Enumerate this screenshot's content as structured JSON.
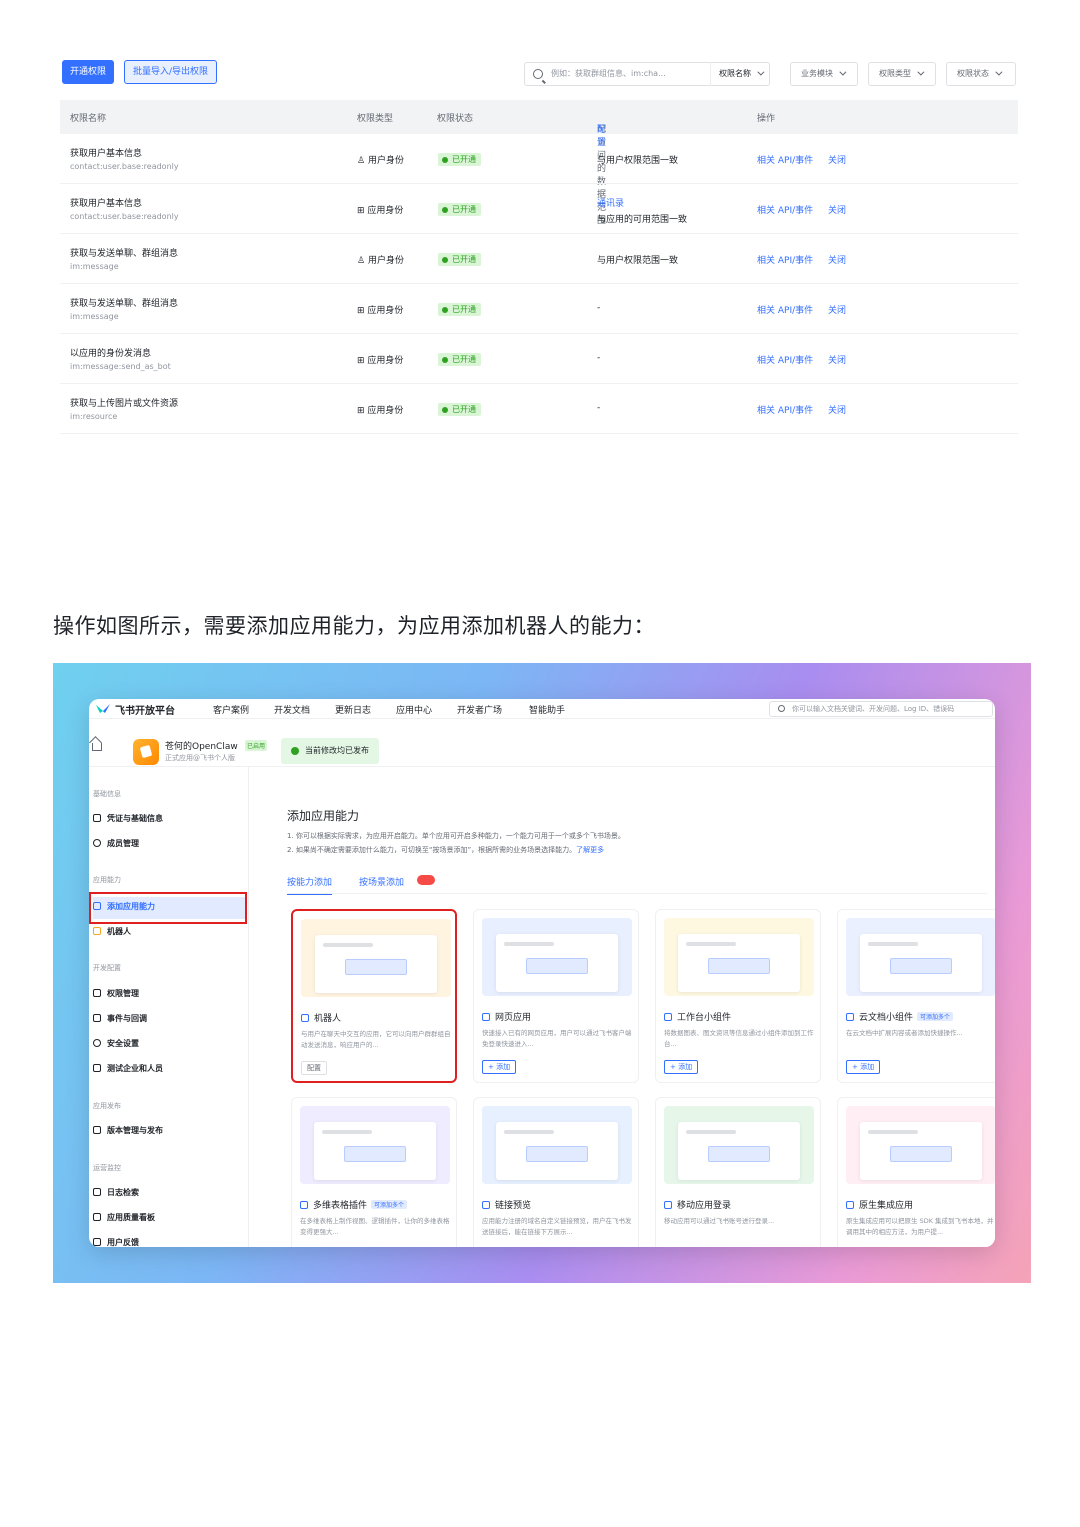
{
  "permissions": {
    "toolbar": {
      "enable_button": "开通权限",
      "batch_button": "批量导入/导出权限",
      "search_placeholder": "例如：获取群组信息、im:cha...",
      "search_field": "权限名称",
      "filters": [
        "业务模块",
        "权限类型",
        "权限状态"
      ]
    },
    "headers": {
      "name": "权限名称",
      "type": "权限类型",
      "status": "权限状态",
      "range": "可访问的数据范围",
      "range_link": "配置",
      "actions": "操作"
    },
    "rows": [
      {
        "name": "获取用户基本信息",
        "scope": "contact:user.base:readonly",
        "type": "用户身份",
        "status": "已开通",
        "range": "与用户权限范围一致",
        "range_link": "",
        "api": "相关 API/事件",
        "close": "关闭"
      },
      {
        "name": "获取用户基本信息",
        "scope": "contact:user.base:readonly",
        "type": "应用身份",
        "status": "已开通",
        "range": "与应用的可用范围一致",
        "range_link": "通讯录",
        "api": "相关 API/事件",
        "close": "关闭"
      },
      {
        "name": "获取与发送单聊、群组消息",
        "scope": "im:message",
        "type": "用户身份",
        "status": "已开通",
        "range": "与用户权限范围一致",
        "range_link": "",
        "api": "相关 API/事件",
        "close": "关闭"
      },
      {
        "name": "获取与发送单聊、群组消息",
        "scope": "im:message",
        "type": "应用身份",
        "status": "已开通",
        "range": "-",
        "range_link": "",
        "api": "相关 API/事件",
        "close": "关闭"
      },
      {
        "name": "以应用的身份发消息",
        "scope": "im:message:send_as_bot",
        "type": "应用身份",
        "status": "已开通",
        "range": "-",
        "range_link": "",
        "api": "相关 API/事件",
        "close": "关闭"
      },
      {
        "name": "获取与上传图片或文件资源",
        "scope": "im:resource",
        "type": "应用身份",
        "status": "已开通",
        "range": "-",
        "range_link": "",
        "api": "相关 API/事件",
        "close": "关闭"
      }
    ]
  },
  "paragraph": "操作如图所示，需要添加应用能力，为应用添加机器人的能力：",
  "console": {
    "brand": "飞书开放平台",
    "nav": [
      "客户案例",
      "开发文档",
      "更新日志",
      "应用中心",
      "开发者广场",
      "智能助手"
    ],
    "search_placeholder": "你可以输入文档关键词、开发问题、Log ID、错误码",
    "app": {
      "name": "苍何的OpenClaw",
      "tag": "已启用",
      "desc": "正式应用@飞书个人版",
      "publish_status": "当前修改均已发布"
    },
    "sidebar": {
      "groups": [
        {
          "label": "基础信息",
          "items": [
            "凭证与基础信息",
            "成员管理"
          ]
        },
        {
          "label": "应用能力",
          "items": [
            "添加应用能力",
            "机器人"
          ]
        },
        {
          "label": "开发配置",
          "items": [
            "权限管理",
            "事件与回调",
            "安全设置",
            "测试企业和人员"
          ]
        },
        {
          "label": "应用发布",
          "items": [
            "版本管理与发布"
          ]
        },
        {
          "label": "运营监控",
          "items": [
            "日志检索",
            "应用质量看板",
            "用户反馈"
          ]
        }
      ]
    },
    "content": {
      "title": "添加应用能力",
      "note1": "1. 你可以根据实际需求，为应用开启能力。单个应用可开启多种能力，一个能力可用于一个或多个飞书场景。",
      "note2": "2. 如果尚不确定需要添加什么能力，可切换至“按场景添加”，根据所需的业务场景选择能力。",
      "note_link": "了解更多",
      "tabs": [
        "按能力添加",
        "按场景添加"
      ],
      "cards": [
        {
          "title": "机器人",
          "tag": "",
          "desc": "与用户在聊天中交互的应用，它可以向用户群群组自动发送消息，响应用户的...",
          "button": "配置"
        },
        {
          "title": "网页应用",
          "tag": "",
          "desc": "快速接入已有的网页应用，用户可以通过飞书客户端免登录快速进入...",
          "button": "+ 添加"
        },
        {
          "title": "工作台小组件",
          "tag": "",
          "desc": "将数据图表、图文资讯等信息通过小组件添加到工作台...",
          "button": "+ 添加"
        },
        {
          "title": "云文档小组件",
          "tag": "可添加多个",
          "desc": "在云文档中扩展内容或者添加快捷操作...",
          "button": "+ 添加"
        },
        {
          "title": "多维表格插件",
          "tag": "可添加多个",
          "desc": "在多维表格上制作视图、逻辑插件，让你的多维表格变得更强大...",
          "button": "+ 添加"
        },
        {
          "title": "链接预览",
          "tag": "",
          "desc": "应用能力注册的域名自定义链接预览，用户在飞书发送链接后，能在链接下方展示...",
          "button": "+ 添加"
        },
        {
          "title": "移动应用登录",
          "tag": "",
          "desc": "移动应用可以通过飞书账号进行登录...",
          "button": "+ 添加"
        },
        {
          "title": "原生集成应用",
          "tag": "",
          "desc": "原生集成应用可以把原生 SDK 集成到飞书本地，并调用其中的相应方法，为用户提...",
          "button": "+ 添加"
        }
      ]
    }
  }
}
